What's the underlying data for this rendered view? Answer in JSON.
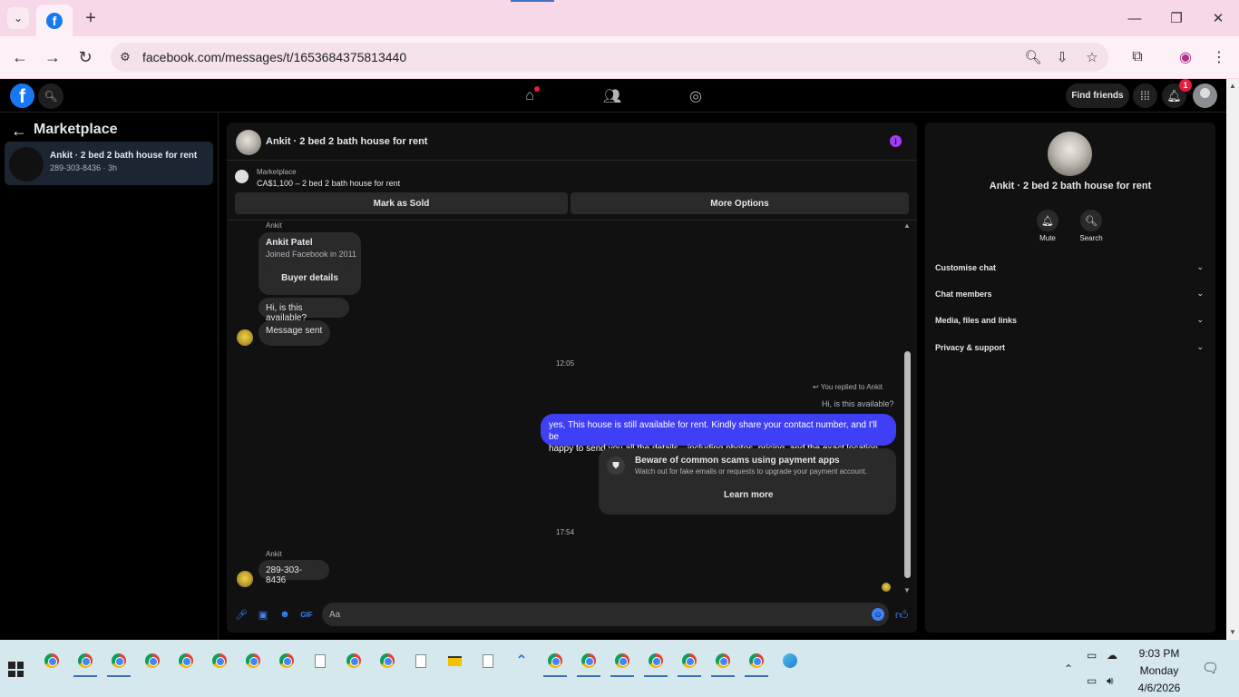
{
  "browser": {
    "url": "facebook.com/messages/t/1653684375813440",
    "new_tab_label": "+"
  },
  "fb_header": {
    "find_friends": "Find friends",
    "notification_count": "1"
  },
  "left_panel": {
    "title": "Marketplace",
    "conversations": [
      {
        "name": "Ankit · 2 bed 2 bath house for rent",
        "subtitle": "289-303-8436 · 3h"
      }
    ]
  },
  "chat": {
    "title": "Ankit · 2 bed 2 bath house for rent",
    "marketplace_label": "Marketplace",
    "listing": "CA$1,100 – 2 bed 2 bath house for rent",
    "mark_sold": "Mark as Sold",
    "more_options": "More Options",
    "messages": {
      "sender1": "Ankit",
      "buyer_name": "Ankit Patel",
      "buyer_joined": "Joined Facebook in 2011",
      "buyer_details": "Buyer details",
      "msg1": "Hi, is this available?",
      "msg2": "Message sent",
      "time1": "12:05",
      "reply_note": "You replied to Ankit",
      "quoted": "Hi, is this available?",
      "reply_line1": "yes, This house is still available for rent. Kindly share your contact number, and I'll be",
      "reply_line2": "happy to send you all the details—including photos, pricing, and the exact location",
      "scam_title": "Beware of common scams using payment apps",
      "scam_text": "Watch out for fake emails or requests to upgrade your payment account.",
      "learn_more": "Learn more",
      "time2": "17:54",
      "sender2": "Ankit",
      "msg3": "289-303-8436"
    },
    "composer_placeholder": "Aa"
  },
  "right_panel": {
    "title": "Ankit · 2 bed 2 bath house for rent",
    "mute": "Mute",
    "search": "Search",
    "sections": [
      "Customise chat",
      "Chat members",
      "Media, files and links",
      "Privacy & support"
    ]
  },
  "taskbar": {
    "time": "9:03 PM",
    "day": "Monday",
    "date": "4/6/2026"
  }
}
